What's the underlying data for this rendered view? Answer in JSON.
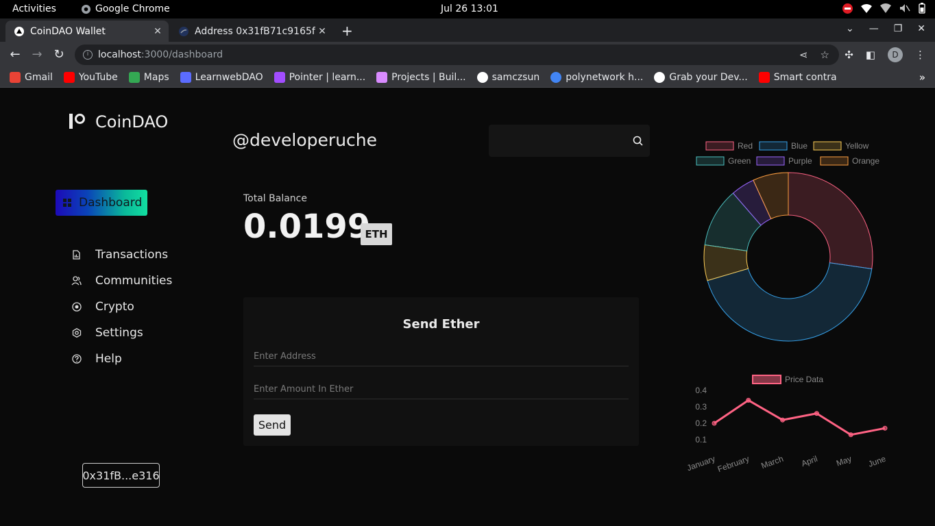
{
  "system": {
    "activities": "Activities",
    "app_name": "Google Chrome",
    "clock": "Jul 26  13:01"
  },
  "tabs": [
    {
      "label": "CoinDAO Wallet"
    },
    {
      "label": "Address 0x31fB71c9165fc"
    }
  ],
  "address_bar": {
    "host": "localhost",
    "path": ":3000/dashboard"
  },
  "profile_initial": "D",
  "bookmarks": [
    {
      "label": "Gmail",
      "icon": "gmail-icon",
      "color": "#ea4335"
    },
    {
      "label": "YouTube",
      "icon": "youtube-icon",
      "color": "#ff0000"
    },
    {
      "label": "Maps",
      "icon": "maps-icon",
      "color": "#34a853"
    },
    {
      "label": "LearnwebDAO",
      "icon": "learnweb3-icon",
      "color": "#5b6cff"
    },
    {
      "label": "Pointer | learn...",
      "icon": "pointer-icon",
      "color": "#a24dff"
    },
    {
      "label": "Projects | Buil...",
      "icon": "unicorn-icon",
      "color": "#d98bff"
    },
    {
      "label": "samczsun",
      "icon": "circle-icon",
      "color": "#ffffff"
    },
    {
      "label": "polynetwork h...",
      "icon": "google-icon",
      "color": "#4285f4"
    },
    {
      "label": "Grab your Dev...",
      "icon": "devfolio-icon",
      "color": "#ffffff"
    },
    {
      "label": "Smart contra",
      "icon": "youtube-icon",
      "color": "#ff0000"
    }
  ],
  "app": {
    "brand": "CoinDAO",
    "dashboard_label": "Dashboard",
    "nav": [
      {
        "label": "Transactions",
        "icon": "report-icon"
      },
      {
        "label": "Communities",
        "icon": "users-icon"
      },
      {
        "label": "Crypto",
        "icon": "coin-icon"
      },
      {
        "label": "Settings",
        "icon": "gear-icon"
      },
      {
        "label": "Help",
        "icon": "help-icon"
      }
    ],
    "wallet_address": "0x31fB...e316",
    "username": "@developeruche",
    "search_placeholder": "",
    "balance_label": "Total Balance",
    "balance_value": "0.0199",
    "balance_unit": "ETH",
    "send_title": "Send Ether",
    "address_placeholder": "Enter Address",
    "amount_placeholder": "Enter Amount In Ether",
    "send_button": "Send"
  },
  "chart_data": [
    {
      "type": "doughnut",
      "categories": [
        "Red",
        "Blue",
        "Yellow",
        "Green",
        "Purple",
        "Orange"
      ],
      "values": [
        12,
        19,
        3,
        5,
        2,
        3
      ],
      "colors": [
        "#ff6384",
        "#36a2eb",
        "#ffce56",
        "#4bc0c0",
        "#9966ff",
        "#ff9f40"
      ],
      "legend": "top"
    },
    {
      "type": "line",
      "categories": [
        "January",
        "February",
        "March",
        "April",
        "May",
        "June"
      ],
      "series": [
        {
          "name": "Price Data",
          "values": [
            0.2,
            0.34,
            0.22,
            0.26,
            0.13,
            0.17
          ]
        }
      ],
      "y_ticks": [
        "0.4",
        "0.3",
        "0.2",
        "0.1"
      ],
      "ylim": [
        0.1,
        0.4
      ],
      "color": "#ff6384",
      "legend": "top"
    }
  ]
}
